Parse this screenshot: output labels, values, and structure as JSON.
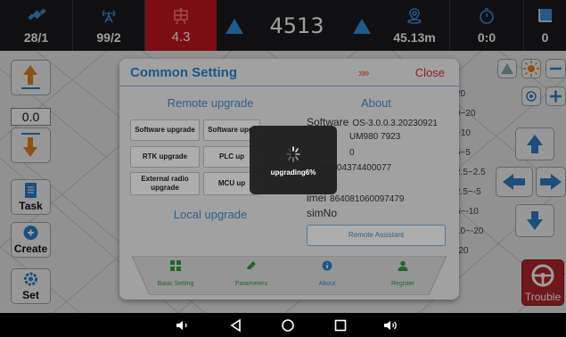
{
  "status_bar": {
    "satellites": {
      "icon": "satellite-icon",
      "value": "28/1"
    },
    "signal": {
      "icon": "signal-antenna-icon",
      "value": "99/2"
    },
    "rtk": {
      "icon": "rtk-base-icon",
      "value": "4.3",
      "color": "#c8151d"
    },
    "count": {
      "value": "4513",
      "icon": "triangle-up-icon",
      "color": "#2f93e4"
    },
    "distance": {
      "icon": "location-pin-icon",
      "value": "45.13m"
    },
    "timer": {
      "icon": "timer-icon",
      "value": "0:0"
    },
    "area": {
      "icon": "square-icon",
      "value": "0"
    }
  },
  "left_panel": {
    "value": "0.0",
    "task_label": "Task",
    "create_label": "Create",
    "set_label": "Set"
  },
  "right_panel": {
    "trouble_label": "Trouble"
  },
  "background_scale": [
    "20",
    "0~20",
    "~10",
    "5~5",
    "2.5~2.5",
    "2.5~-5",
    "5~-10",
    "10~-20",
    "-20"
  ],
  "dialog": {
    "title": "Common Setting",
    "arrows": "»»",
    "close_label": "Close",
    "remote_upgrade_title": "Remote upgrade",
    "about_title": "About",
    "upgrade_buttons": [
      "Software upgrade",
      "Software upgr",
      "RTK upgrade",
      "PLC up",
      "External radio upgrade",
      "MCU up"
    ],
    "local_upgrade_title": "Local upgrade",
    "about_rows": [
      {
        "key": "Software",
        "value": "OS-3.0.0.3.20230921"
      },
      {
        "key": "",
        "value": "UM980 7923"
      },
      {
        "key": "",
        "value": "0"
      },
      {
        "key": "",
        "value": "10TS04374400077"
      },
      {
        "key": "imei",
        "value": "864081060097479"
      },
      {
        "key": "simNo",
        "value": ""
      }
    ],
    "remote_assistant_label": "Remote Assistant",
    "tabs": [
      {
        "label": "Basic Setting",
        "icon": "grid-icon",
        "color": "#2e9a3a"
      },
      {
        "label": "Parameters",
        "icon": "pencil-icon",
        "color": "#2e9a3a"
      },
      {
        "label": "About",
        "icon": "info-icon",
        "color": "#2f7fc7"
      },
      {
        "label": "Register",
        "icon": "user-icon",
        "color": "#2e9a3a"
      }
    ]
  },
  "toast": {
    "text": "upgrading6%",
    "progress_percent": 6
  },
  "nav_bar": {
    "icons": [
      "volume-down-icon",
      "back-icon",
      "home-icon",
      "recents-icon",
      "volume-up-icon"
    ]
  }
}
